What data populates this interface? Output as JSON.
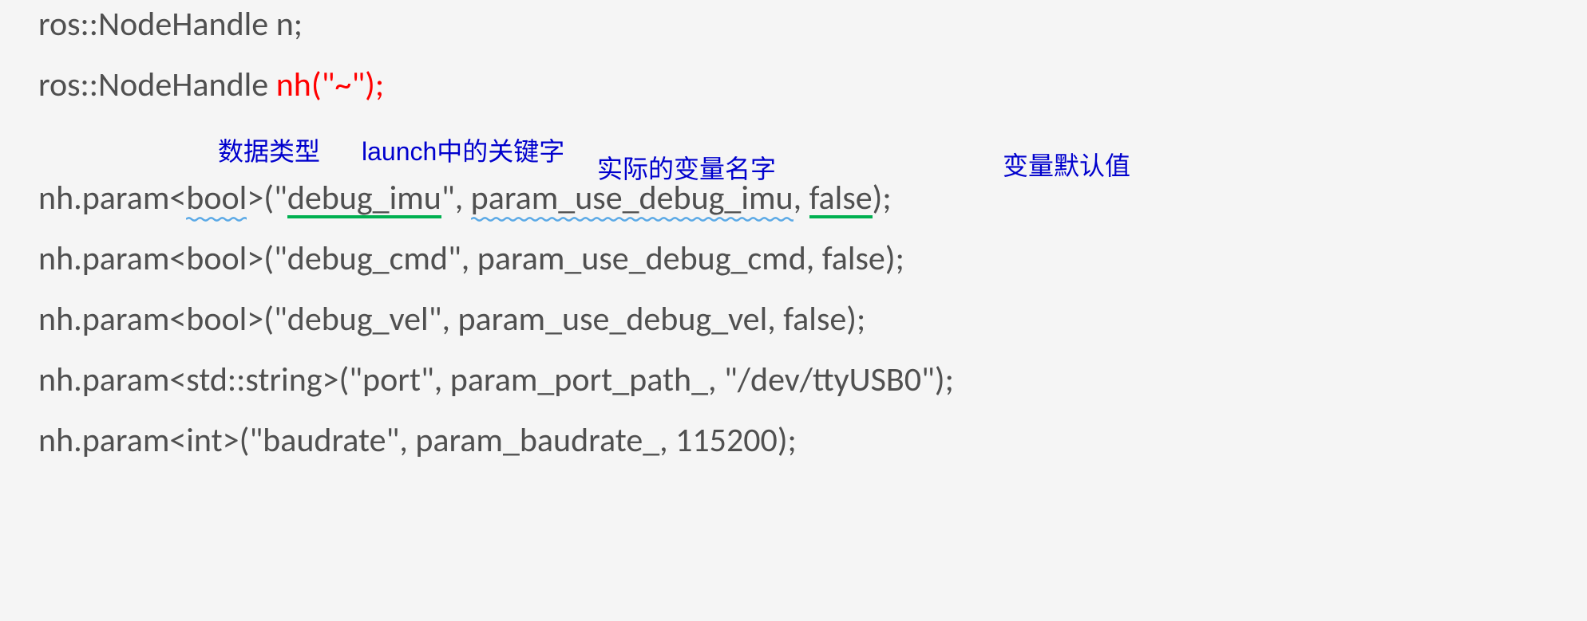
{
  "lines": {
    "l1": "ros::NodeHandle n;",
    "l2_pre": "ros::NodeHandle ",
    "l2_red": "nh(\"~\");",
    "l3_a": "nh.param<",
    "l3_b": "bool",
    "l3_c": ">(\"",
    "l3_d": "debug_imu",
    "l3_e": "\", ",
    "l3_f": "param_use_debug_imu",
    "l3_g": ", ",
    "l3_h": "false",
    "l3_i": ");",
    "l4": "nh.param<bool>(\"debug_cmd\", param_use_debug_cmd, false);",
    "l5": "nh.param<bool>(\"debug_vel\", param_use_debug_vel, false);",
    "l6": "nh.param<std::string>(\"port\", param_port_path_, \"/dev/ttyUSB0\");",
    "l7": "nh.param<int>(\"baudrate\", param_baudrate_, 115200);"
  },
  "annotations": {
    "a1": "数据类型",
    "a2": "launch中的关键字",
    "a3": "实际的变量名字",
    "a4": "变量默认值"
  }
}
